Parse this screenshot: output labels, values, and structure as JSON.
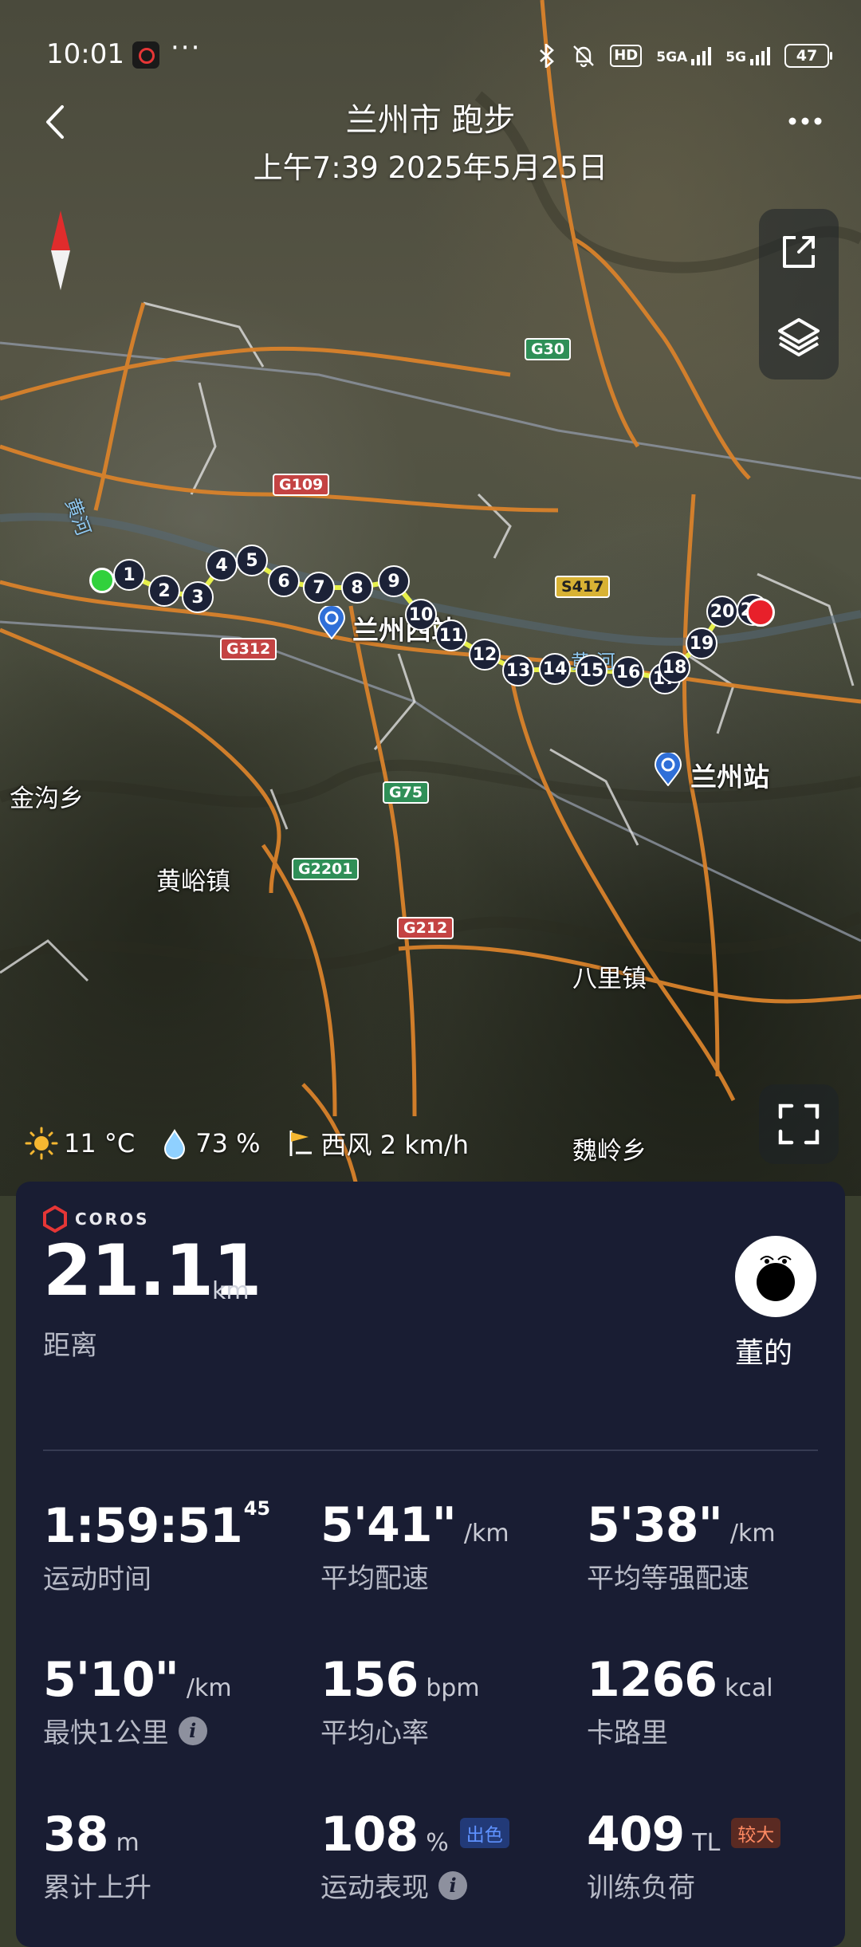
{
  "status_bar": {
    "time": "10:01",
    "more": "···",
    "network1": "5GA",
    "network2": "5G",
    "hd": "HD",
    "battery": "47"
  },
  "header": {
    "title": "兰州市 跑步",
    "subtitle": "上午7:39 2025年5月25日"
  },
  "map": {
    "places": {
      "jingou": "金沟乡",
      "huangyu": "黄峪镇",
      "bali": "八里镇",
      "weiling": "魏岭乡"
    },
    "river": "黄河",
    "river2": "黄 河",
    "stations": {
      "west": "兰州西站",
      "main": "兰州站"
    },
    "shields": {
      "g30": "G30",
      "g109": "G109",
      "s417": "S417",
      "g312": "G312",
      "g75": "G75",
      "g2201": "G2201",
      "g212": "G212"
    },
    "km_markers": [
      "1",
      "2",
      "3",
      "4",
      "5",
      "6",
      "7",
      "8",
      "9",
      "10",
      "11",
      "12",
      "13",
      "14",
      "15",
      "16",
      "17",
      "18",
      "19",
      "20",
      "21"
    ]
  },
  "weather": {
    "temperature": "11 °C",
    "humidity": "73  %",
    "wind": "西风 2 km/h"
  },
  "card": {
    "brand": "COROS",
    "distance": {
      "value": "21.11",
      "unit": "km",
      "label": "距离"
    },
    "user_name": "董的",
    "metrics": {
      "time": {
        "value": "1:59:51",
        "sup": "45",
        "label": "运动时间"
      },
      "avg_pace": {
        "value": "5'41\"",
        "unit": "/km",
        "label": "平均配速"
      },
      "grade_pace": {
        "value": "5'38\"",
        "unit": "/km",
        "label": "平均等强配速"
      },
      "fastest_km": {
        "value": "5'10\"",
        "unit": "/km",
        "label": "最快1公里"
      },
      "heart_rate": {
        "value": "156",
        "unit": "bpm",
        "label": "平均心率"
      },
      "calories": {
        "value": "1266",
        "unit": "kcal",
        "label": "卡路里"
      },
      "ascent": {
        "value": "38",
        "unit": "m",
        "label": "累计上升"
      },
      "performance": {
        "value": "108",
        "unit": "%",
        "tag": "出色",
        "label": "运动表现"
      },
      "training_load": {
        "value": "409",
        "unit": "TL",
        "tag": "较大",
        "label": "训练负荷"
      }
    }
  },
  "colors": {
    "card_bg": "#191d33",
    "start": "#31d13c",
    "end": "#e8202a",
    "route": "#e6ef4a",
    "road": "#d9822b"
  }
}
